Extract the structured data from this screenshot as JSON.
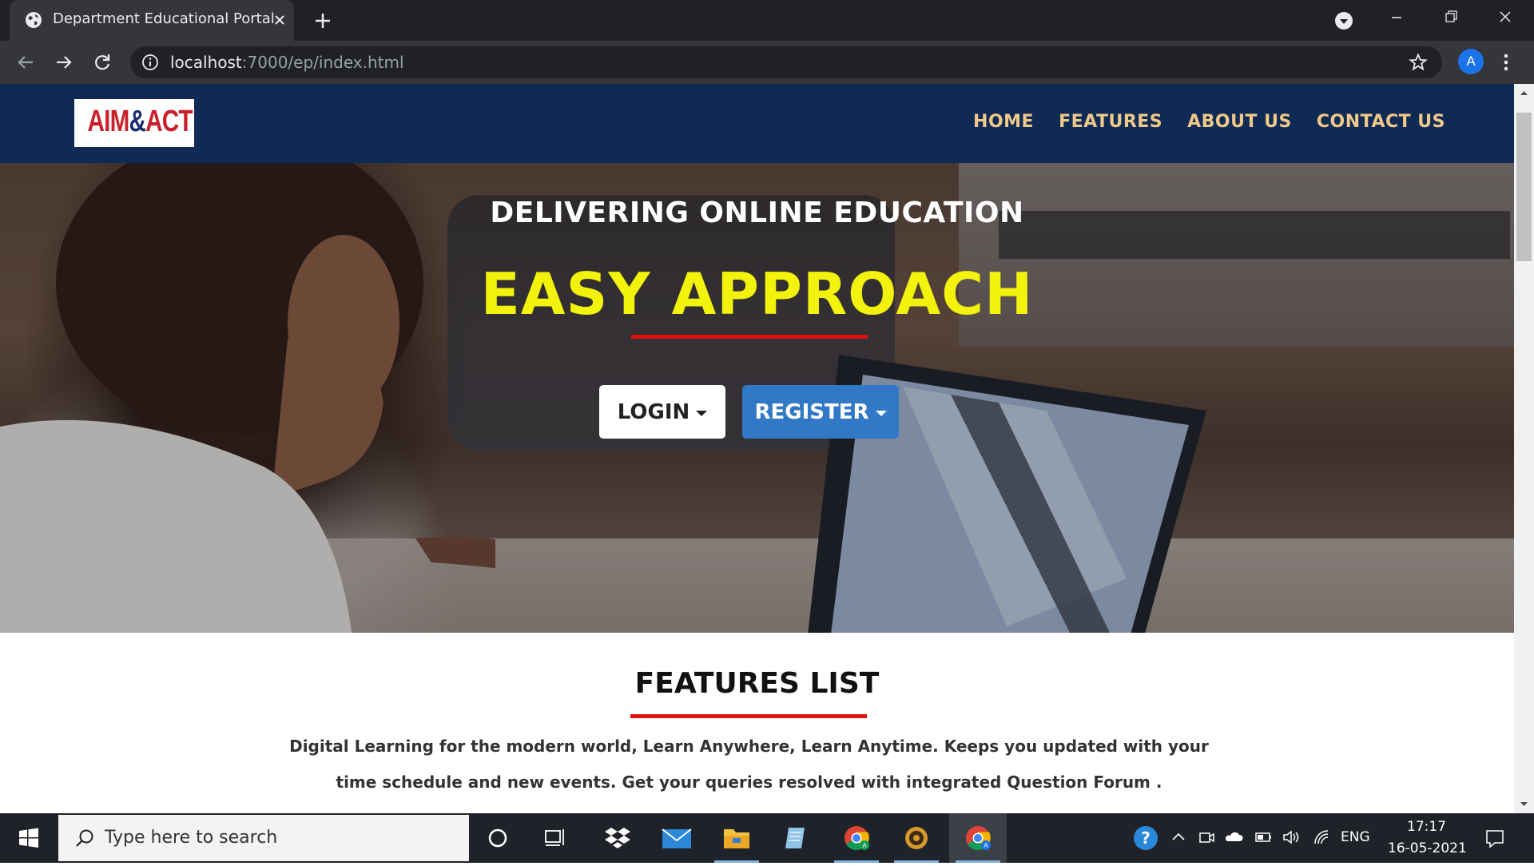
{
  "browser": {
    "tab_title": "Department Educational Portal",
    "url_host": "localhost",
    "url_rest": ":7000/ep/index.html",
    "profile_initial": "A"
  },
  "site": {
    "logo": {
      "part1": "AIM",
      "amp": "&",
      "part2": "ACT"
    },
    "nav": [
      "HOME",
      "FEATURES",
      "ABOUT US",
      "CONTACT US"
    ],
    "hero": {
      "subtitle": "DELIVERING ONLINE EDUCATION",
      "title": "EASY APPROACH",
      "login_label": "LOGIN",
      "register_label": "REGISTER"
    },
    "features": {
      "title": "FEATURES LIST",
      "description": "Digital Learning for the modern world, Learn Anywhere, Learn Anytime. Keeps you updated with your time schedule and new events. Get your queries resolved with integrated Question Forum ."
    },
    "colors": {
      "nav_bg": "#0f2a55",
      "nav_link": "#f0c98a",
      "hero_title": "#f2f20c",
      "accent_red": "#e01010",
      "register_bg": "#3178c6"
    }
  },
  "taskbar": {
    "search_placeholder": "Type here to search",
    "language": "ENG",
    "time": "17:17",
    "date": "16-05-2021",
    "apps": [
      "cortana-icon",
      "task-view-icon",
      "dropbox-icon",
      "mail-icon",
      "file-explorer-icon",
      "notepad-icon",
      "chrome-icon",
      "settings-app-icon",
      "chrome-profile-icon"
    ]
  }
}
